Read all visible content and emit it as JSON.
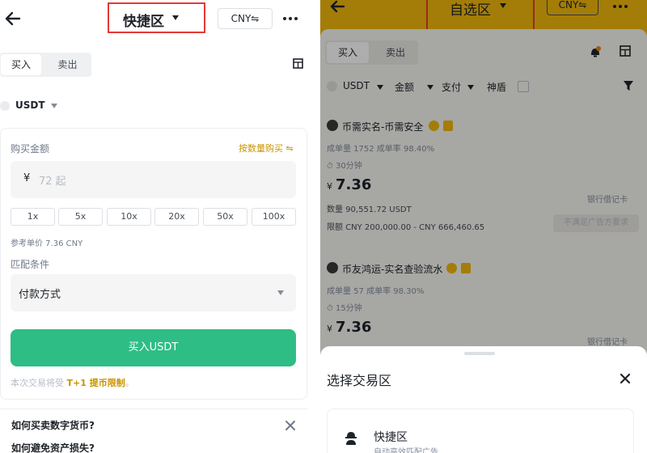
{
  "left": {
    "zone_title": "快捷区",
    "currency_btn": "CNY⇋",
    "tabs": {
      "buy": "买入",
      "sell": "卖出"
    },
    "asset": "USDT",
    "amount_label": "购买金额",
    "by_quantity": "按数量购买 ⇋",
    "currency_symbol": "¥",
    "amount_placeholder": "72 起",
    "multipliers": [
      "1x",
      "5x",
      "10x",
      "20x",
      "50x",
      "100x"
    ],
    "ref_price": "参考单价 7.36 CNY",
    "match_label": "匹配条件",
    "payment_method": "付款方式",
    "buy_button": "买入USDT",
    "t1_prefix": "本次交易将受 ",
    "t1_highlight": "T+1 提币限制",
    "t1_suffix": "。",
    "faq": [
      "如何买卖数字货币?",
      "如何避免资产损失?"
    ]
  },
  "right": {
    "title": "自选区",
    "currency_btn": "CNY⇋",
    "tabs": {
      "buy": "买入",
      "sell": "卖出"
    },
    "filters": {
      "asset": "USDT",
      "amount": "金额",
      "pay": "支付",
      "shield": "神盾"
    },
    "merchants": [
      {
        "name": "币需实名-币需安全",
        "stats": "成单量 1752  成单率 98.40%",
        "time": "30分钟",
        "currency": "¥",
        "price": "7.36",
        "pay_method": "银行借记卡",
        "quantity": "数量 90,551.72 USDT",
        "limit": "限额 CNY 200,000.00 - CNY 666,460.65",
        "status": "不满足广告方要求"
      },
      {
        "name": "币友鸿运-实名查验流水",
        "stats": "成单量 57  成单率 98.30%",
        "time": "15分钟",
        "currency": "¥",
        "price": "7.36",
        "pay_method": "银行借记卡"
      }
    ],
    "sheet": {
      "title": "选择交易区",
      "option_title": "快捷区",
      "option_sub": "自动高效匹配广告"
    }
  },
  "colors": {
    "brand_yellow": "#F0B90B",
    "buy_green": "#2EBD85",
    "highlight_red": "#E53935",
    "link_gold": "#C99400"
  }
}
